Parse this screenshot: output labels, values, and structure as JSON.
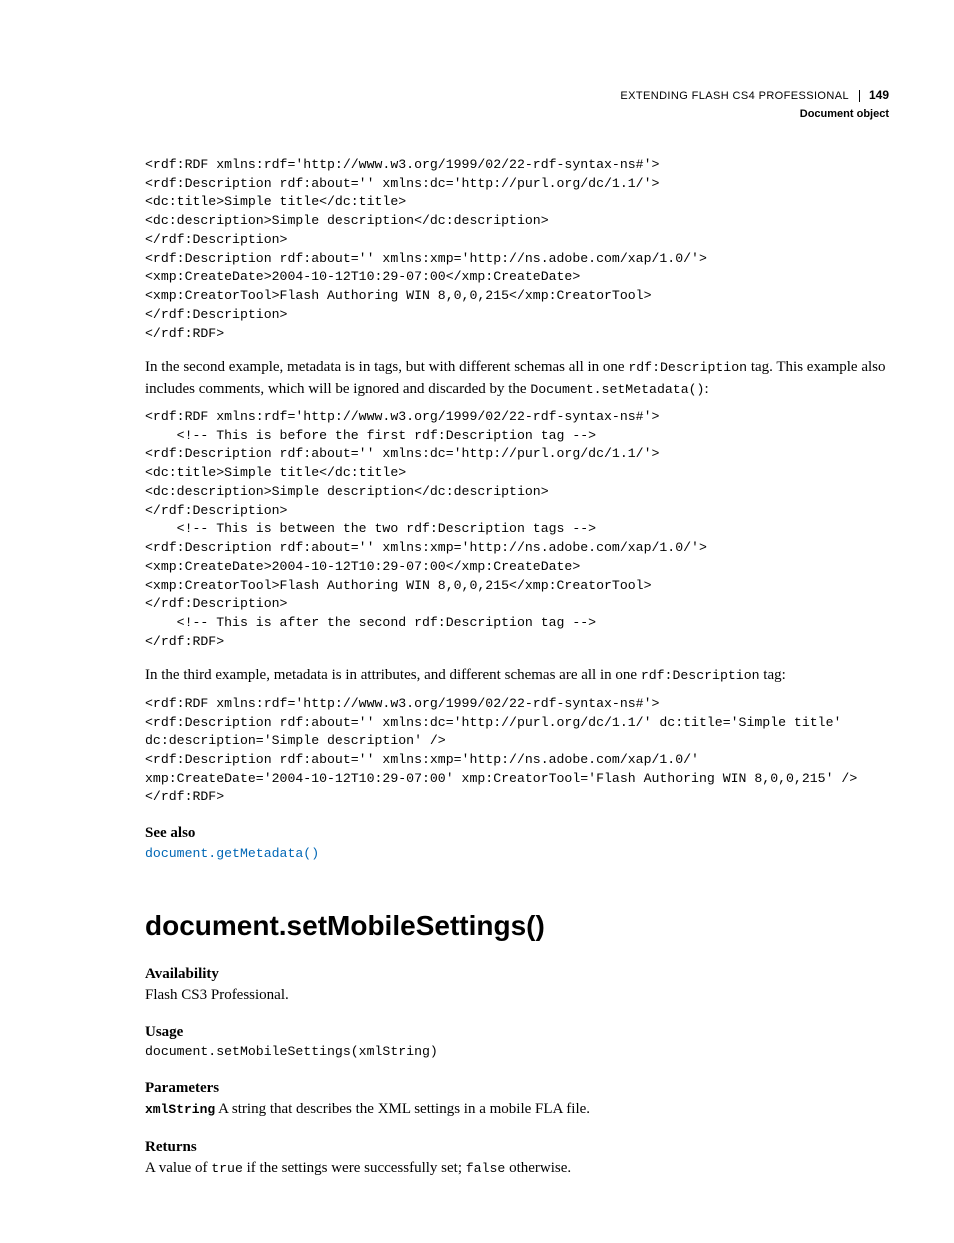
{
  "header": {
    "title": "EXTENDING FLASH CS4 PROFESSIONAL",
    "pageNumber": "149",
    "section": "Document object"
  },
  "code1": "<rdf:RDF xmlns:rdf='http://www.w3.org/1999/02/22-rdf-syntax-ns#'>\n<rdf:Description rdf:about='' xmlns:dc='http://purl.org/dc/1.1/'>\n<dc:title>Simple title</dc:title>\n<dc:description>Simple description</dc:description>\n</rdf:Description>\n<rdf:Description rdf:about='' xmlns:xmp='http://ns.adobe.com/xap/1.0/'>\n<xmp:CreateDate>2004-10-12T10:29-07:00</xmp:CreateDate>\n<xmp:CreatorTool>Flash Authoring WIN 8,0,0,215</xmp:CreatorTool>\n</rdf:Description>\n</rdf:RDF>",
  "para1": {
    "t1": "In the second example, metadata is in tags, but with different schemas all in one ",
    "c1": "rdf:Description",
    "t2": " tag. This example also includes comments, which will be ignored and discarded by the ",
    "c2": "Document.setMetadata()",
    "t3": ":"
  },
  "code2": "<rdf:RDF xmlns:rdf='http://www.w3.org/1999/02/22-rdf-syntax-ns#'>\n    <!-- This is before the first rdf:Description tag -->\n<rdf:Description rdf:about='' xmlns:dc='http://purl.org/dc/1.1/'>\n<dc:title>Simple title</dc:title>\n<dc:description>Simple description</dc:description>\n</rdf:Description>\n    <!-- This is between the two rdf:Description tags -->\n<rdf:Description rdf:about='' xmlns:xmp='http://ns.adobe.com/xap/1.0/'>\n<xmp:CreateDate>2004-10-12T10:29-07:00</xmp:CreateDate>\n<xmp:CreatorTool>Flash Authoring WIN 8,0,0,215</xmp:CreatorTool>\n</rdf:Description>\n    <!-- This is after the second rdf:Description tag -->\n</rdf:RDF>",
  "para2": {
    "t1": "In the third example, metadata is in attributes, and different schemas are all in one ",
    "c1": "rdf:Description",
    "t2": " tag:"
  },
  "code3": "<rdf:RDF xmlns:rdf='http://www.w3.org/1999/02/22-rdf-syntax-ns#'>\n<rdf:Description rdf:about='' xmlns:dc='http://purl.org/dc/1.1/' dc:title='Simple title' \ndc:description='Simple description' />\n<rdf:Description rdf:about='' xmlns:xmp='http://ns.adobe.com/xap/1.0/' \nxmp:CreateDate='2004-10-12T10:29-07:00' xmp:CreatorTool='Flash Authoring WIN 8,0,0,215' />\n</rdf:RDF>",
  "seeAlso": {
    "label": "See also",
    "link": "document.getMetadata()"
  },
  "method": {
    "heading": "document.setMobileSettings()",
    "availability": {
      "label": "Availability",
      "text": "Flash CS3 Professional."
    },
    "usage": {
      "label": "Usage",
      "code": "document.setMobileSettings(xmlString)"
    },
    "parameters": {
      "label": "Parameters",
      "paramName": "xmlString",
      "paramDesc": "  A string that describes the XML settings in a mobile FLA file."
    },
    "returns": {
      "label": "Returns",
      "t1": "A value of ",
      "c1": "true",
      "t2": " if the settings were successfully set; ",
      "c2": "false",
      "t3": " otherwise."
    }
  }
}
